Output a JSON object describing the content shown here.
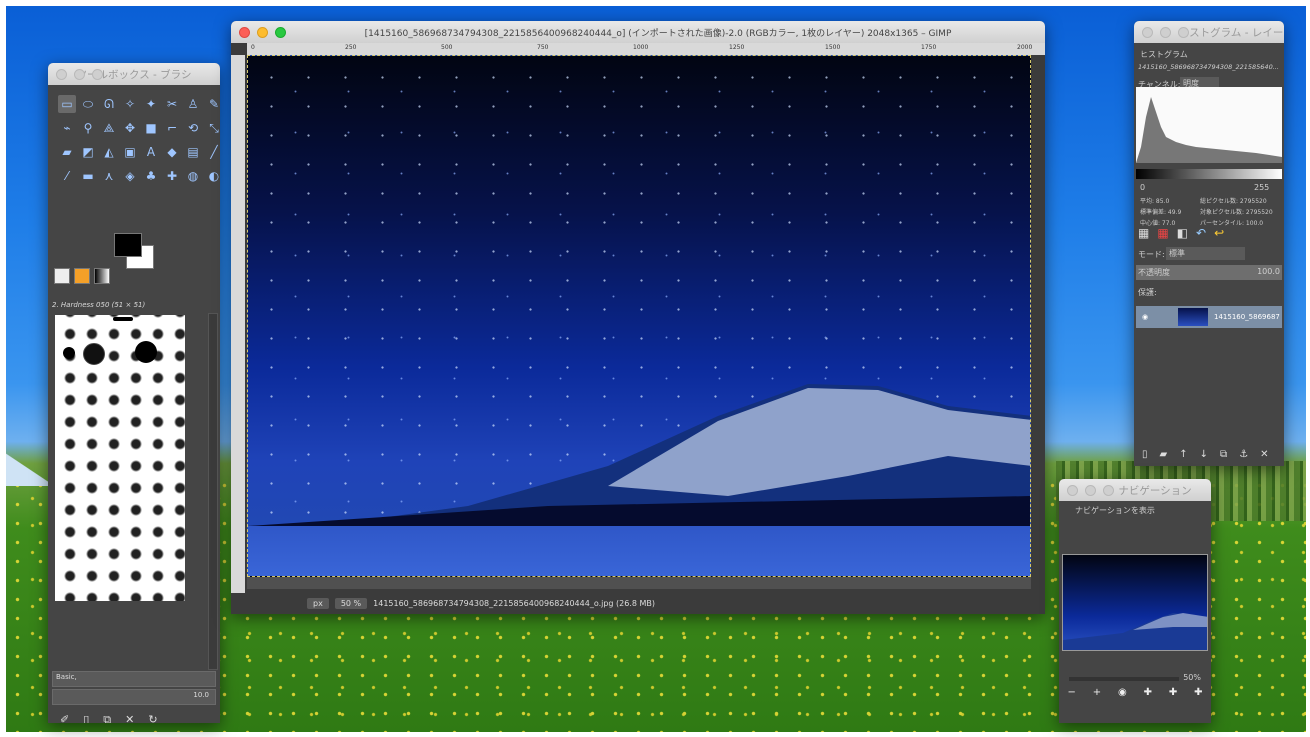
{
  "toolbox": {
    "title": "ツールボックス - ブラシ",
    "brush_label": "2. Hardness 050 (51 × 51)",
    "preset": "Basic,",
    "spacing_value": "10.0"
  },
  "main": {
    "title": "[1415160_586968734794308_2215856400968240444_o] (インポートされた画像)-2.0 (RGBカラー, 1枚のレイヤー) 2048x1365 – GIMP",
    "ruler": [
      "0",
      "250",
      "500",
      "750",
      "1000",
      "1250",
      "1500",
      "1750",
      "2000"
    ],
    "unit": "px",
    "zoom": "50 %",
    "status": "1415160_586968734794308_2215856400968240444_o.jpg (26.8 MB)"
  },
  "histogram": {
    "title": "ヒストグラム - レイー",
    "tab_label": "ヒストグラム",
    "subtitle": "1415160_586968734794308_221585640...",
    "channel_label": "チャンネル:",
    "channel_value": "明度",
    "range_min": "0",
    "range_max": "255",
    "stats": [
      "平均: 85.0",
      "標準偏差: 49.9",
      "中心値: 77.0",
      "総ピクセル数: 2795520",
      "対象ピクセル数: 2795520",
      "パーセンタイル: 100.0"
    ],
    "mode_label": "モード:",
    "mode_value": "標準",
    "opacity_label": "不透明度",
    "opacity_value": "100.0",
    "lock_label": "保護:",
    "layer_name": "1415160_5869687"
  },
  "navigation": {
    "title": "ナビゲーション",
    "tab_label": "ナビゲーションを表示",
    "zoom_percent": "50%"
  },
  "icons": {
    "zoom_out": "−",
    "zoom_in": "+"
  }
}
